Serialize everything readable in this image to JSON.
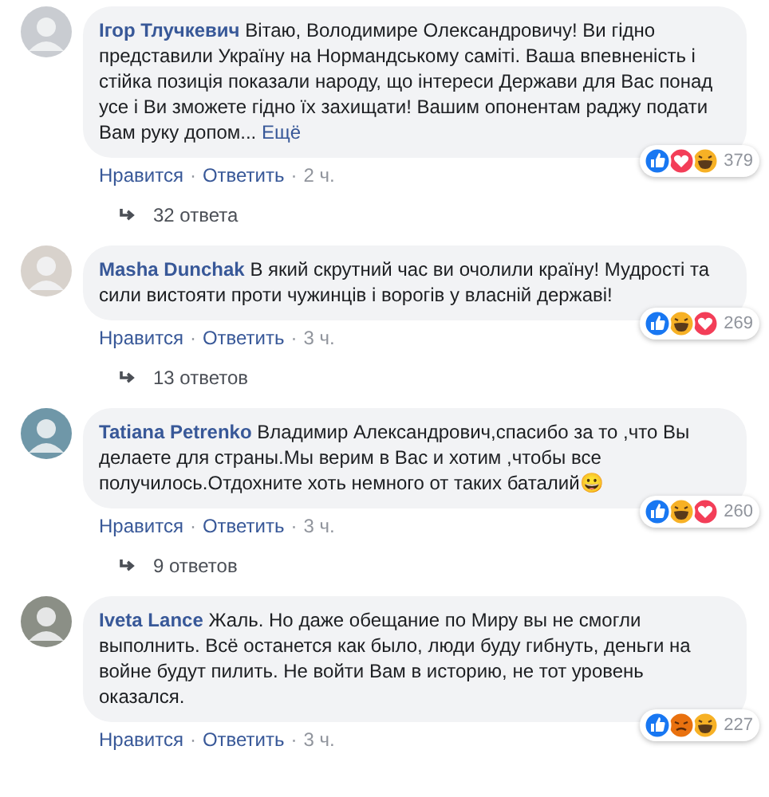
{
  "action_separator": "·",
  "comments": [
    {
      "author": "Ігор Тлучкевич",
      "text": "Вітаю, Володимире Олександровичу! Ви гідно представили Україну на Нормандському саміті. Ваша впевненість і стійка позиція показали народу, що інтереси Держави для Вас понад усе і Ви зможете гідно їх захищати! Вашим опонентам раджу подати Вам руку допом...",
      "more": "Ещё",
      "reactions": [
        {
          "kind": "like"
        },
        {
          "kind": "love"
        },
        {
          "kind": "haha"
        }
      ],
      "reaction_count": "379",
      "like_label": "Нравится",
      "reply_label": "Ответить",
      "time": "2 ч.",
      "replies": "32 ответа"
    },
    {
      "author": "Masha Dunchak",
      "text": "В який скрутний час ви очолили країну! Мудрості та сили вистояти проти чужинців і ворогів у власній державі!",
      "reactions": [
        {
          "kind": "like"
        },
        {
          "kind": "haha"
        },
        {
          "kind": "love"
        }
      ],
      "reaction_count": "269",
      "like_label": "Нравится",
      "reply_label": "Ответить",
      "time": "3 ч.",
      "replies": "13 ответов"
    },
    {
      "author": "Tatiana Petrenko",
      "text": "Владимир Александрович,спасибо за то ,что Вы делаете для страны.Мы верим в Вас и хотим ,чтобы все получилось.Отдохните хоть немного от таких баталий😀",
      "reactions": [
        {
          "kind": "like"
        },
        {
          "kind": "haha"
        },
        {
          "kind": "love"
        }
      ],
      "reaction_count": "260",
      "like_label": "Нравится",
      "reply_label": "Ответить",
      "time": "3 ч.",
      "replies": "9 ответов"
    },
    {
      "author": "Iveta Lance",
      "text": "Жаль. Но даже обещание по Миру вы не смогли выполнить. Всё останется как было, люди буду гибнуть, деньги на войне будут пилить. Не войти Вам в историю, не тот уровень оказался.",
      "reactions": [
        {
          "kind": "like"
        },
        {
          "kind": "angry"
        },
        {
          "kind": "haha"
        }
      ],
      "reaction_count": "227",
      "like_label": "Нравится",
      "reply_label": "Ответить",
      "time": "3 ч."
    }
  ]
}
